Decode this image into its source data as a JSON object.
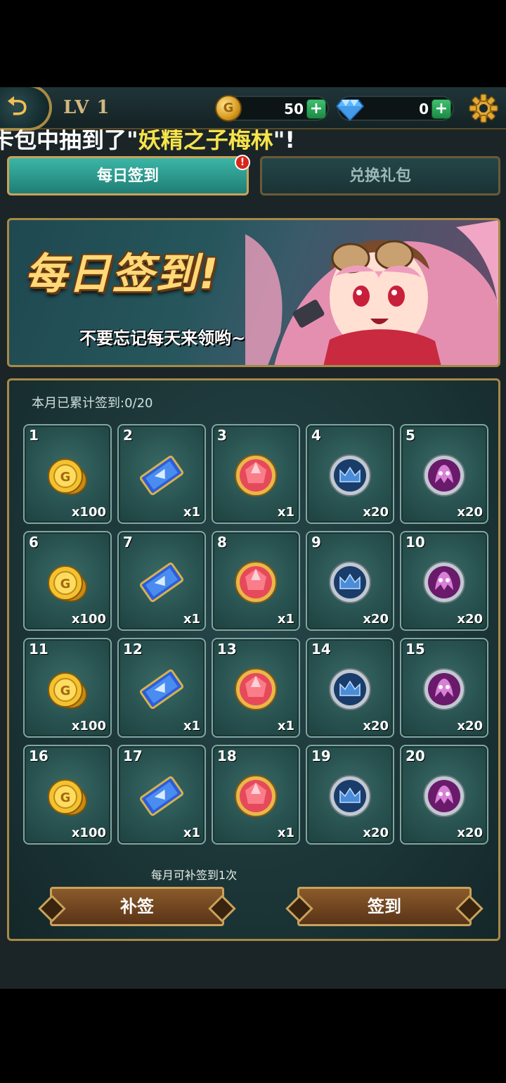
{
  "topbar": {
    "level": "LV 1",
    "gold": "50",
    "diamonds": "0",
    "plus": "+"
  },
  "ticker": {
    "prefix": "卡包中抽到了\"",
    "highlight": "妖精之子梅林",
    "suffix": "\"!"
  },
  "tabs": {
    "daily_signin": "每日签到",
    "redeem_gift": "兑换礼包",
    "badge": "!"
  },
  "banner": {
    "title": "每日签到!",
    "subtitle": "不要忘记每天来领哟~"
  },
  "panel": {
    "progress": "本月已累计签到:0/20",
    "rule": "每月可补签到1次",
    "makeup_button": "补签",
    "signin_button": "签到"
  },
  "rewards": [
    {
      "day": "1",
      "qty": "x100",
      "item": "gold-coins"
    },
    {
      "day": "2",
      "qty": "x1",
      "item": "ticket"
    },
    {
      "day": "3",
      "qty": "x1",
      "item": "red-gem"
    },
    {
      "day": "4",
      "qty": "x20",
      "item": "blue-crown-orb"
    },
    {
      "day": "5",
      "qty": "x20",
      "item": "purple-orb"
    },
    {
      "day": "6",
      "qty": "x100",
      "item": "gold-coins"
    },
    {
      "day": "7",
      "qty": "x1",
      "item": "ticket"
    },
    {
      "day": "8",
      "qty": "x1",
      "item": "red-gem"
    },
    {
      "day": "9",
      "qty": "x20",
      "item": "blue-crown-orb"
    },
    {
      "day": "10",
      "qty": "x20",
      "item": "purple-orb"
    },
    {
      "day": "11",
      "qty": "x100",
      "item": "gold-coins"
    },
    {
      "day": "12",
      "qty": "x1",
      "item": "ticket"
    },
    {
      "day": "13",
      "qty": "x1",
      "item": "red-gem"
    },
    {
      "day": "14",
      "qty": "x20",
      "item": "blue-crown-orb"
    },
    {
      "day": "15",
      "qty": "x20",
      "item": "purple-orb"
    },
    {
      "day": "16",
      "qty": "x100",
      "item": "gold-coins"
    },
    {
      "day": "17",
      "qty": "x1",
      "item": "ticket"
    },
    {
      "day": "18",
      "qty": "x1",
      "item": "red-gem"
    },
    {
      "day": "19",
      "qty": "x20",
      "item": "blue-crown-orb"
    },
    {
      "day": "20",
      "qty": "x20",
      "item": "purple-orb"
    }
  ]
}
